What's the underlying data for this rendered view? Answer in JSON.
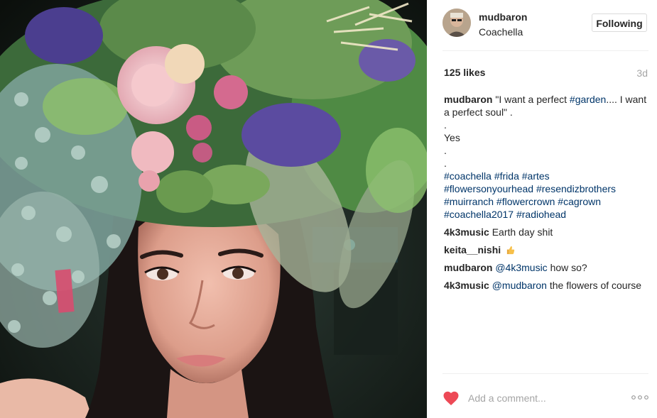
{
  "post": {
    "photo_alt": "",
    "username": "mudbaron",
    "location": "Coachella",
    "follow_label": "Following",
    "likes": "125 likes",
    "time_ago": "3d"
  },
  "caption": {
    "user": "mudbaron",
    "text_before": "\"I want a perfect ",
    "hashtag_garden": "#garden",
    "text_after": ".... I want a perfect soul\" .",
    "dot1": ".",
    "yes": "Yes",
    "dot2": ".",
    "dot3": ".",
    "tags": {
      "coachella": "#coachella",
      "frida": "#frida",
      "artes": "#artes",
      "flowersonyourhead": "#flowersonyourhead",
      "resendizbrothers": "#resendizbrothers",
      "muirranch": "#muirranch",
      "flowercrown": "#flowercrown",
      "cagrown": "#cagrown",
      "coachella2017": "#coachella2017",
      "radiohead": "#radiohead"
    }
  },
  "comments": [
    {
      "user": "4k3music",
      "text": "Earth day shit"
    },
    {
      "user": "keita__nishi",
      "emoji_name": "thumbs-up-emoji"
    },
    {
      "user": "mudbaron",
      "mention": "@4k3music",
      "text": " how so?"
    },
    {
      "user": "4k3music",
      "mention": "@mudbaron",
      "text": " the flowers of course"
    }
  ],
  "footer": {
    "comment_placeholder": "Add a comment...",
    "heart_icon": "heart-icon",
    "more_icon": "more-options-icon"
  },
  "colors": {
    "heart": "#ed4956",
    "hashtag": "#003569",
    "muted": "#a5a5a5",
    "divider": "#efefef"
  }
}
